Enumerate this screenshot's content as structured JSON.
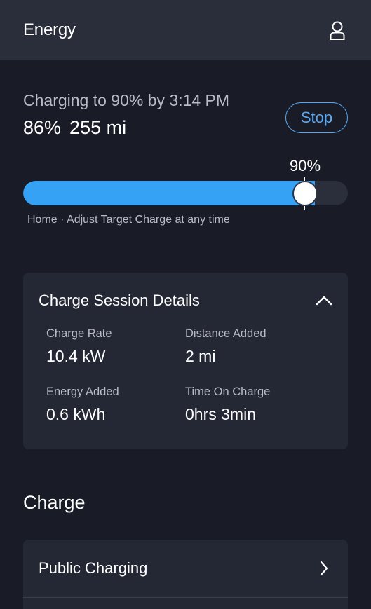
{
  "header": {
    "title": "Energy",
    "profile_icon": "person-icon"
  },
  "charging": {
    "target_text": "Charging to 90% by 3:14 PM",
    "battery_percent": "86%",
    "range": "255 mi",
    "stop_label": "Stop",
    "target_label": "90%",
    "current_level": 0.86,
    "target_level": 0.9,
    "hint": "Home · Adjust Target Charge at any time"
  },
  "session": {
    "title": "Charge Session Details",
    "toggle_icon": "chevron-up-icon",
    "charge_rate_label": "Charge Rate",
    "charge_rate_value": "10.4 kW",
    "distance_label": "Distance Added",
    "distance_value": "2 mi",
    "energy_label": "Energy Added",
    "energy_value": "0.6 kWh",
    "time_label": "Time On Charge",
    "time_value": "0hrs 3min"
  },
  "charge_section": {
    "title": "Charge",
    "items": [
      {
        "label": "Public Charging",
        "icon": "chevron-right-icon"
      }
    ]
  },
  "colors": {
    "background": "#191c26",
    "header": "#2a2e3a",
    "card": "#242835",
    "accent": "#35a2f6",
    "stop_accent": "#58a9f5",
    "muted_text": "#b9bcc6"
  }
}
